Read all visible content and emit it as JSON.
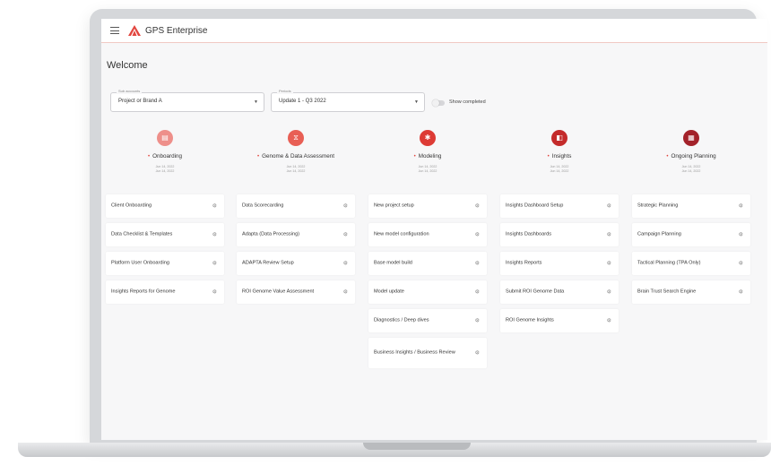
{
  "app": {
    "brand": "GPS Enterprise"
  },
  "welcome": "Welcome",
  "filters": {
    "sub_accounts": {
      "label": "Sub accounts",
      "value": "Project or Brand A"
    },
    "periods": {
      "label": "Periods",
      "value": "Update 1 - Q3 2022"
    },
    "show_completed": "Show completed"
  },
  "phases": [
    {
      "title": "Onboarding",
      "color": "#ee8f8a",
      "icon": "clipboard-icon",
      "dates": [
        "Jun 14, 2022",
        "Jun 14, 2022"
      ],
      "items": [
        "Client Onboarding",
        "Data Checklist & Templates",
        "Platform User Onboarding",
        "Insights Reports for Genome"
      ]
    },
    {
      "title": "Genome & Data Assessment",
      "color": "#e85f55",
      "icon": "dna-icon",
      "dates": [
        "Jun 14, 2022",
        "Jun 14, 2022"
      ],
      "items": [
        "Data Scorecarding",
        "Adapta (Data Processing)",
        "ADAPTA Review Setup",
        "ROI Genome Value Assessment"
      ]
    },
    {
      "title": "Modeling",
      "color": "#dd3b35",
      "icon": "network-icon",
      "dates": [
        "Jun 14, 2022",
        "Jun 14, 2022"
      ],
      "items": [
        "New project setup",
        "New model configuration",
        "Base model build",
        "Model update",
        "Diagnostics / Deep dives",
        "Business Insights / Business Review"
      ]
    },
    {
      "title": "Insights",
      "color": "#c42b2b",
      "icon": "insights-icon",
      "dates": [
        "Jun 14, 2022",
        "Jun 14, 2022"
      ],
      "items": [
        "Insights Dashboard Setup",
        "Insights Dashboards",
        "Insights Reports",
        "Submit ROI Genome Data",
        "ROI Genome Insights"
      ]
    },
    {
      "title": "Ongoing Planning",
      "color": "#a3222a",
      "icon": "calendar-icon",
      "dates": [
        "Jun 14, 2022",
        "Jun 14, 2022"
      ],
      "items": [
        "Strategic Planning",
        "Campaign Planning",
        "Tactical Planning (TPA Only)",
        "Brain Trust Search Engine"
      ]
    }
  ]
}
